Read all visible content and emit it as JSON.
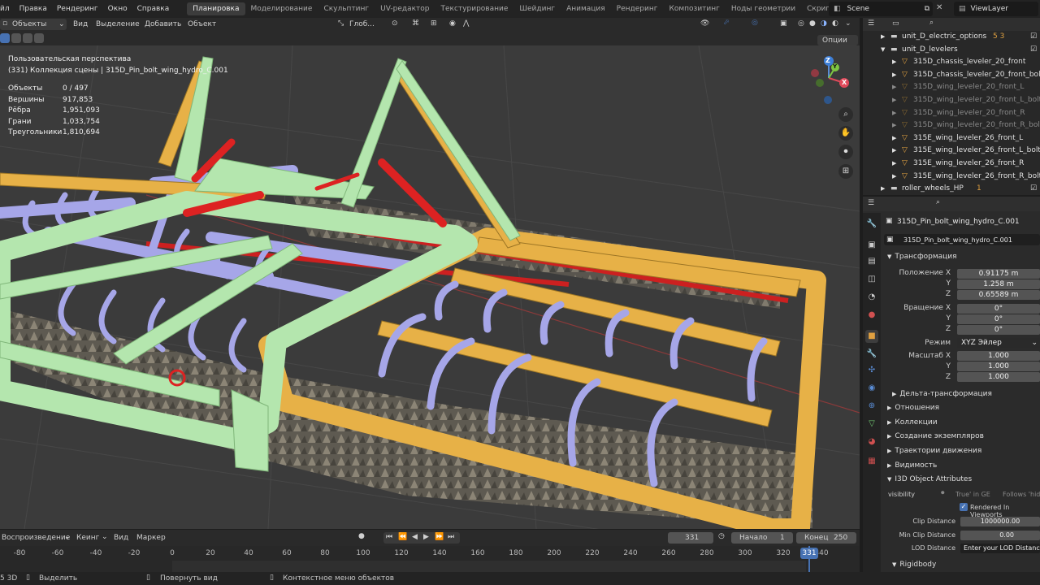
{
  "topbar": {
    "menus": [
      "йл",
      "Правка",
      "Рендеринг",
      "Окно",
      "Справка"
    ],
    "workspaces": [
      "Планировка",
      "Моделирование",
      "Скульптинг",
      "UV-редактор",
      "Текстурирование",
      "Шейдинг",
      "Анимация",
      "Рендеринг",
      "Композитинг",
      "Ноды геометрии",
      "Скриптинг"
    ],
    "active_workspace": "Планировка",
    "add_tab": "+",
    "scene": "Scene",
    "view_layer": "ViewLayer"
  },
  "viewport_header": {
    "mode": "Объекты",
    "menus": [
      "Вид",
      "Выделение",
      "Добавить",
      "Объект"
    ],
    "orientation": "Глоб...",
    "options": "Опции"
  },
  "viewport": {
    "view_name": "Пользовательская перспектива",
    "collection_info": "(331) Коллекция сцены | 315D_Pin_bolt_wing_hydro_C.001",
    "stats": [
      {
        "label": "Объекты",
        "value": "0 / 497"
      },
      {
        "label": "Вершины",
        "value": "917,853"
      },
      {
        "label": "Рёбра",
        "value": "1,951,093"
      },
      {
        "label": "Грани",
        "value": "1,033,754"
      },
      {
        "label": "Треугольники",
        "value": "1,810,694"
      }
    ],
    "gizmo": {
      "z": "Z",
      "y": "Y",
      "x": "X"
    }
  },
  "outliner": {
    "rows": [
      {
        "label": "unit_D_electric_options",
        "badge": "5  3",
        "indent": 1,
        "dim": false
      },
      {
        "label": "unit_D_levelers",
        "badge": "",
        "indent": 1,
        "dim": false
      },
      {
        "label": "315D_chassis_leveler_20_front",
        "badge": "",
        "indent": 2,
        "dim": false
      },
      {
        "label": "315D_chassis_leveler_20_front_bol",
        "badge": "",
        "indent": 2,
        "dim": false
      },
      {
        "label": "315D_wing_leveler_20_front_L",
        "badge": "",
        "indent": 2,
        "dim": true
      },
      {
        "label": "315D_wing_leveler_20_front_L_bolt",
        "badge": "",
        "indent": 2,
        "dim": true
      },
      {
        "label": "315D_wing_leveler_20_front_R",
        "badge": "",
        "indent": 2,
        "dim": true
      },
      {
        "label": "315D_wing_leveler_20_front_R_bolt",
        "badge": "",
        "indent": 2,
        "dim": true
      },
      {
        "label": "315E_wing_leveler_26_front_L",
        "badge": "",
        "indent": 2,
        "dim": false
      },
      {
        "label": "315E_wing_leveler_26_front_L_bolt",
        "badge": "",
        "indent": 2,
        "dim": false
      },
      {
        "label": "315E_wing_leveler_26_front_R",
        "badge": "",
        "indent": 2,
        "dim": false
      },
      {
        "label": "315E_wing_leveler_26_front_R_bolt",
        "badge": "",
        "indent": 2,
        "dim": false
      },
      {
        "label": "roller_wheels_HP",
        "badge": "1",
        "indent": 1,
        "dim": false
      }
    ]
  },
  "properties": {
    "object_name": "315D_Pin_bolt_wing_hydro_C.001",
    "object_field": "315D_Pin_bolt_wing_hydro_C.001",
    "transform_title": "Трансформация",
    "location_label": "Положение X",
    "location": [
      "0.91175 m",
      "1.258 m",
      "0.65589 m"
    ],
    "rotation_label": "Вращение X",
    "rotation": [
      "0°",
      "0°",
      "0°"
    ],
    "mode_label": "Режим",
    "mode_value": "XYZ Эйлер",
    "scale_label": "Масштаб X",
    "scale": [
      "1.000",
      "1.000",
      "1.000"
    ],
    "y": "Y",
    "z": "Z",
    "delta": "Дельта-трансформация",
    "sections": [
      "Отношения",
      "Коллекции",
      "Создание экземпляров",
      "Траектории движения",
      "Видимость",
      "I3D Object Attributes"
    ],
    "visibility_label": "visibility",
    "true_in_ge": "True' in GE",
    "follows_hide": "Follows 'hide_",
    "rendered_in_viewports": "Rendered In Viewports",
    "clip_label": "Clip Distance",
    "clip_value": "1000000.00",
    "min_clip_label": "Min Clip Distance",
    "min_clip_value": "0.00",
    "lod_label": "LOD Distance",
    "lod_placeholder": "Enter your LOD Distances if",
    "rigidbody": "Rigidbody"
  },
  "timeline": {
    "menus": [
      "Воспроизведение",
      "Кеинг",
      "Вид",
      "Маркер"
    ],
    "current_frame": "331",
    "start_label": "Начало",
    "start": "1",
    "end_label": "Конец",
    "end": "250",
    "ticks": [
      -80,
      -60,
      -40,
      -20,
      0,
      20,
      40,
      60,
      80,
      100,
      120,
      140,
      160,
      180,
      200,
      220,
      240,
      260,
      280,
      300,
      320,
      340
    ]
  },
  "statusbar": {
    "version": "5 3D",
    "select": "Выделить",
    "rotate": "Повернуть вид",
    "context": "Контекстное меню объектов"
  },
  "colors": {
    "accent": "#4772b3",
    "frame_orange": "#e7b147",
    "frame_green": "#b4e6ae",
    "tine_lavender": "#a6a6e8",
    "cylinder_red": "#dd2222"
  }
}
